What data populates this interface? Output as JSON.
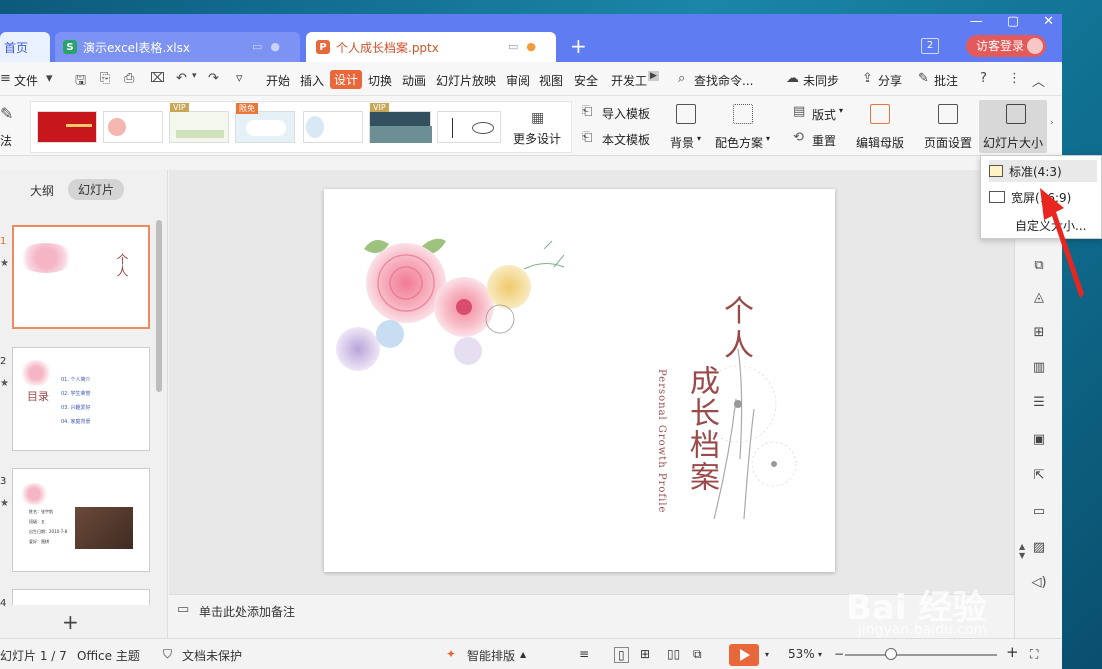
{
  "tabs": [
    {
      "label": "首页"
    },
    {
      "label": "演示excel表格.xlsx",
      "icon": "S"
    },
    {
      "label": "个人成长档案.pptx",
      "icon": "P"
    }
  ],
  "tab_count": "2",
  "login": "访客登录",
  "menu": {
    "file": "文件",
    "items": [
      "开始",
      "插入",
      "设计",
      "切换",
      "动画",
      "幻灯片放映",
      "审阅",
      "视图",
      "安全",
      "开发工"
    ],
    "search": "查找命令...",
    "sync": "未同步",
    "share": "分享",
    "comment": "批注"
  },
  "ribbon": {
    "left_partial": "法",
    "more_designs": "更多设计",
    "import_template": "导入模板",
    "this_template": "本文模板",
    "background": "背景",
    "color_scheme": "配色方案",
    "layout": "版式",
    "reset": "重置",
    "edit_master": "编辑母版",
    "page_setup": "页面设置",
    "slide_size": "幻灯片大小",
    "vip_label": "VIP",
    "free_label": "限免"
  },
  "left_panel": {
    "outline_tab": "大纲",
    "slides_tab": "幻灯片",
    "slide_numbers": [
      "1",
      "2",
      "3",
      "4"
    ],
    "thumb1_title": "个人",
    "thumb2_title": "目录",
    "thumb2_items": [
      "01. 个人简介",
      "02. 学生荣誉",
      "03. 兴趣爱好",
      "04. 家庭背景"
    ],
    "thumb3_lines": [
      "姓名：张宇航",
      "班级：五",
      "出生日期：2010-7-8",
      "爱好：围棋"
    ]
  },
  "slide": {
    "title_1": "个人",
    "title_2": "成长档案",
    "subtitle": "Personal Growth Profile"
  },
  "notes": "单击此处添加备注",
  "dropdown": {
    "standard": "标准(4:3)",
    "widescreen": "宽屏(16:9)",
    "custom": "自定义大小..."
  },
  "status": {
    "slide_info": "幻灯片 1 / 7",
    "theme": "Office 主题",
    "protection": "文档未保护",
    "smart_layout": "智能排版",
    "zoom": "53%"
  },
  "watermark": {
    "main": "Bai 经验",
    "sub": "jingyan.baidu.com"
  },
  "colors": {
    "accent": "#e8673b",
    "titlebar": "#5f7cf2",
    "slide_title": "#9a4a4a"
  }
}
